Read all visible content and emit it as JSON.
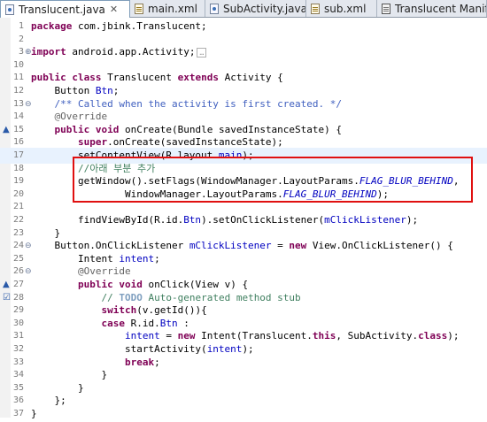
{
  "tabs": [
    {
      "label": "Translucent.java",
      "close": "✕",
      "icon": "java-file-icon",
      "active": true
    },
    {
      "label": "main.xml",
      "icon": "xml-file-icon"
    },
    {
      "label": "SubActivity.java",
      "icon": "java-file-icon"
    },
    {
      "label": "sub.xml",
      "icon": "xml-file-icon"
    },
    {
      "label": "Translucent Manifest",
      "icon": "manifest-icon"
    }
  ],
  "editor": {
    "current_line": "17",
    "highlight_box_color": "#e01010",
    "lines": [
      {
        "n": "1",
        "code": "package com.jbink.Translucent;"
      },
      {
        "n": "2",
        "code": ""
      },
      {
        "n": "3",
        "code": "import android.app.Activity;",
        "fold": "⊕",
        "folded": "…"
      },
      {
        "n": "10",
        "code": ""
      },
      {
        "n": "11",
        "code": "public class Translucent extends Activity {"
      },
      {
        "n": "12",
        "code": "    Button Btn;"
      },
      {
        "n": "13",
        "code": "    /** Called when the activity is first created. */",
        "fold": "⊖"
      },
      {
        "n": "14",
        "code": "    @Override"
      },
      {
        "n": "15",
        "code": "    public void onCreate(Bundle savedInstanceState) {",
        "marker": "▲"
      },
      {
        "n": "16",
        "code": "        super.onCreate(savedInstanceState);"
      },
      {
        "n": "17",
        "code": "        setContentView(R.layout.main);"
      },
      {
        "n": "18",
        "code": "        //아래 부분 추가"
      },
      {
        "n": "19",
        "code": "        getWindow().setFlags(WindowManager.LayoutParams.FLAG_BLUR_BEHIND,"
      },
      {
        "n": "20",
        "code": "                WindowManager.LayoutParams.FLAG_BLUR_BEHIND);"
      },
      {
        "n": "21",
        "code": ""
      },
      {
        "n": "22",
        "code": "        findViewById(R.id.Btn).setOnClickListener(mClickListener);"
      },
      {
        "n": "23",
        "code": "    }"
      },
      {
        "n": "24",
        "code": "    Button.OnClickListener mClickListener = new View.OnClickListener() {",
        "fold": "⊖"
      },
      {
        "n": "25",
        "code": "        Intent intent;"
      },
      {
        "n": "26",
        "code": "        @Override",
        "fold": "⊖"
      },
      {
        "n": "27",
        "code": "        public void onClick(View v) {",
        "marker": "▲"
      },
      {
        "n": "28",
        "code": "            // TODO Auto-generated method stub",
        "marker": "☑"
      },
      {
        "n": "29",
        "code": "            switch(v.getId()){"
      },
      {
        "n": "30",
        "code": "            case R.id.Btn :"
      },
      {
        "n": "31",
        "code": "                intent = new Intent(Translucent.this, SubActivity.class);"
      },
      {
        "n": "32",
        "code": "                startActivity(intent);"
      },
      {
        "n": "33",
        "code": "                break;"
      },
      {
        "n": "34",
        "code": "            }"
      },
      {
        "n": "35",
        "code": "        }"
      },
      {
        "n": "36",
        "code": "    };"
      },
      {
        "n": "37",
        "code": "}"
      }
    ]
  }
}
